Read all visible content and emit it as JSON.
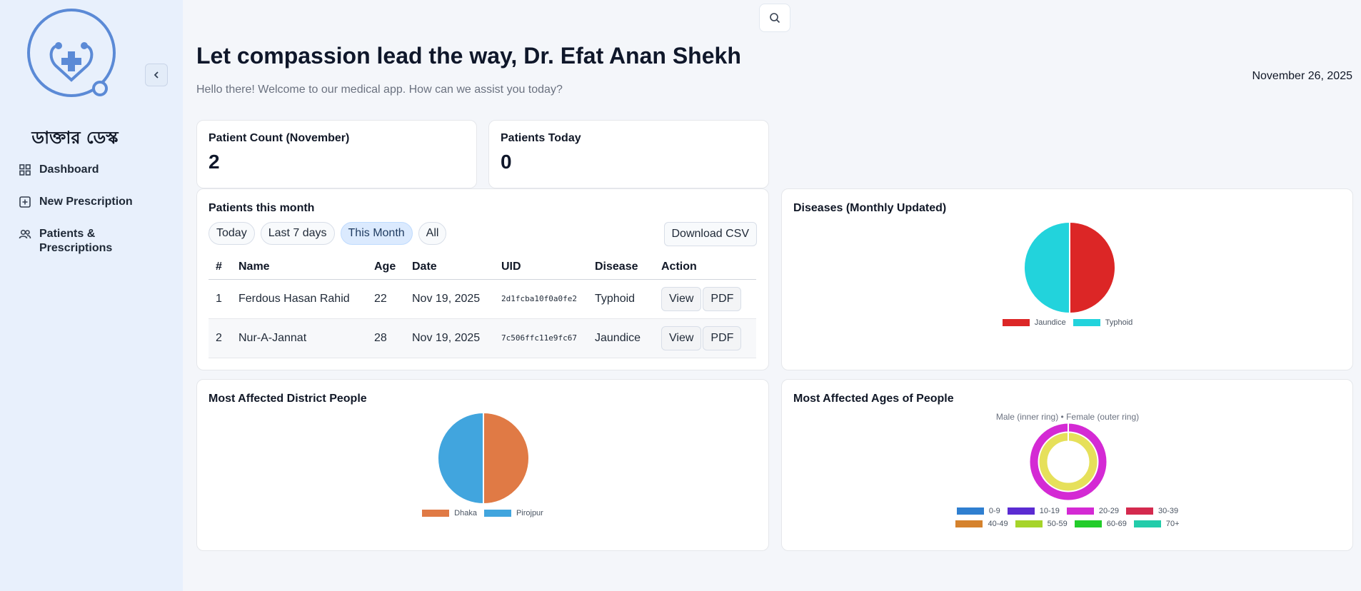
{
  "sidebar": {
    "brand": "ডাক্তার ডেস্ক",
    "items": [
      {
        "label": "Dashboard"
      },
      {
        "label": "New Prescription"
      },
      {
        "label": "Patients & Prescriptions"
      }
    ]
  },
  "header": {
    "title": "Let compassion lead the way, Dr. Efat Anan Shekh",
    "subtitle": "Hello there! Welcome to our medical app. How can we assist you today?",
    "date": "November 26, 2025"
  },
  "stats": [
    {
      "label": "Patient Count (November)",
      "value": "2"
    },
    {
      "label": "Patients Today",
      "value": "0"
    }
  ],
  "patients": {
    "title": "Patients this month",
    "filters": [
      {
        "label": "Today"
      },
      {
        "label": "Last 7 days"
      },
      {
        "label": "This Month",
        "active": true
      },
      {
        "label": "All"
      }
    ],
    "download_label": "Download CSV",
    "columns": [
      "#",
      "Name",
      "Age",
      "Date",
      "UID",
      "Disease",
      "Action"
    ],
    "rows": [
      {
        "num": "1",
        "name": "Ferdous Hasan Rahid",
        "age": "22",
        "date": "Nov 19, 2025",
        "uid": "2d1fcba10f0a0fe2",
        "disease": "Typhoid"
      },
      {
        "num": "2",
        "name": "Nur-A-Jannat",
        "age": "28",
        "date": "Nov 19, 2025",
        "uid": "7c506ffc11e9fc67",
        "disease": "Jaundice"
      }
    ],
    "view_label": "View",
    "pdf_label": "PDF"
  },
  "chart_data": [
    {
      "type": "pie",
      "title": "Diseases (Monthly Updated)",
      "categories": [
        "Jaundice",
        "Typhoid"
      ],
      "values": [
        1,
        1
      ],
      "colors": [
        "#dc2626",
        "#22d3dc"
      ],
      "legend": "bottom"
    },
    {
      "type": "pie",
      "title": "Most Affected District People",
      "categories": [
        "Dhaka",
        "Pirojpur"
      ],
      "values": [
        1,
        1
      ],
      "colors": [
        "#e07a45",
        "#41a5de"
      ],
      "legend": "bottom"
    },
    {
      "type": "pie",
      "title": "Most Affected Ages of People",
      "subtitle": "Male (inner ring) • Female (outer ring)",
      "categories": [
        "0-9",
        "10-19",
        "20-29",
        "30-39",
        "40-49",
        "50-59",
        "60-69",
        "70+"
      ],
      "series": [
        {
          "name": "Male (inner ring)",
          "values": [
            0,
            0,
            1,
            0,
            0,
            0,
            0,
            0
          ]
        },
        {
          "name": "Female (outer ring)",
          "values": [
            0,
            0,
            1,
            0,
            0,
            0,
            0,
            0
          ]
        }
      ],
      "colors": [
        "#2f7fd0",
        "#5b2bd2",
        "#d42ad4",
        "#d42a4e",
        "#d5822d",
        "#a6d42a",
        "#22cc2a",
        "#22ccaa"
      ],
      "ring_colors": {
        "inner": "#e6e05a",
        "outer": "#d42ad4"
      },
      "legend": "bottom"
    }
  ]
}
